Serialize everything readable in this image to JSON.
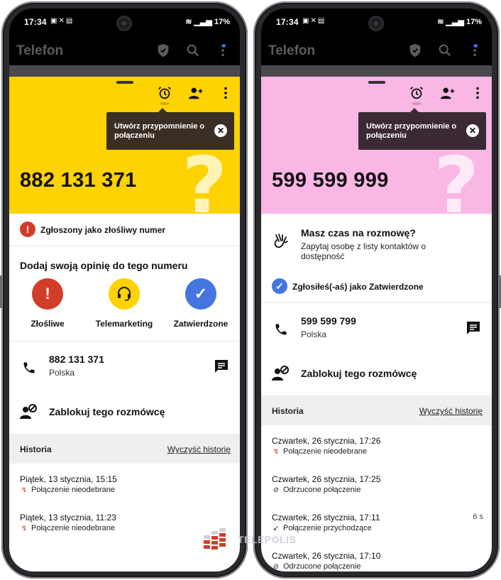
{
  "status_bar": {
    "time": "17:34",
    "battery": "17%"
  },
  "app_bar": {
    "title": "Telefon"
  },
  "tooltip": {
    "text": "Utwórz przypomnienie o połączeniu"
  },
  "history_header": {
    "title": "Historia",
    "clear_label": "Wyczyść historię"
  },
  "left_screen": {
    "header_color": "#ffd202",
    "number": "882 131 371",
    "flag_label": "Zgłoszony jako złośliwy numer",
    "opinion_title": "Dodaj swoją opinię do tego numeru",
    "opinions": [
      {
        "label": "Złośliwe",
        "icon": "exclamation-icon",
        "color": "#d23d2a"
      },
      {
        "label": "Telemarketing",
        "icon": "headset-icon",
        "color": "#ffd202"
      },
      {
        "label": "Zatwierdzone",
        "icon": "check-icon",
        "color": "#4475e0"
      }
    ],
    "contact": {
      "number": "882 131 371",
      "country": "Polska"
    },
    "block_label": "Zablokuj tego rozmówcę",
    "history": [
      {
        "date": "Piątek, 13 stycznia, 15:15",
        "status": "Połączenie nieodebrane",
        "type": "missed"
      },
      {
        "date": "Piątek, 13 stycznia, 11:23",
        "status": "Połączenie nieodebrane",
        "type": "missed"
      }
    ]
  },
  "right_screen": {
    "header_color": "#fab6e4",
    "number": "599 599 999",
    "ask": {
      "title": "Masz czas na rozmowę?",
      "subtitle": "Zapytaj osobę z listy kontaktów o dostępność"
    },
    "flag_label": "Zgłosiłeś(-aś) jako Zatwierdzone",
    "contact": {
      "number": "599 599 799",
      "country": "Polska"
    },
    "block_label": "Zablokuj tego rozmówcę",
    "history": [
      {
        "date": "Czwartek, 26 stycznia, 17:26",
        "status": "Połączenie nieodebrane",
        "type": "missed",
        "duration": ""
      },
      {
        "date": "Czwartek, 26 stycznia, 17:25",
        "status": "Odrzucone połączenie",
        "type": "rejected",
        "duration": ""
      },
      {
        "date": "Czwartek, 26 stycznia, 17:11",
        "status": "Połączenie przychodzące",
        "type": "incoming",
        "duration": "6 s"
      },
      {
        "date": "Czwartek, 26 stycznia, 17:10",
        "status": "Odrzucone połączenie",
        "type": "rejected",
        "duration": ""
      }
    ]
  },
  "watermark": {
    "text": "TELEPOLIS"
  },
  "colors": {
    "malicious": "#d23d2a",
    "approved": "#4475e0",
    "missed": "#d23d2a"
  }
}
